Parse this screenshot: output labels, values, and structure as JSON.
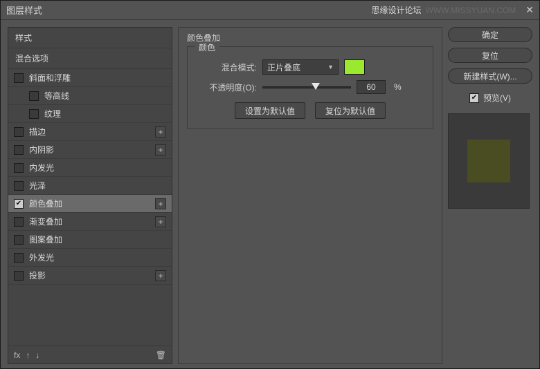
{
  "titlebar": {
    "title": "图层样式",
    "watermark_label": "思缘设计论坛",
    "watermark_url": "WWW.MISSYUAN.COM"
  },
  "left": {
    "styles_header": "样式",
    "blend_header": "混合选项",
    "items": [
      {
        "label": "斜面和浮雕",
        "indent": false,
        "plus": false,
        "checked": false
      },
      {
        "label": "等高线",
        "indent": true,
        "plus": false,
        "checked": false
      },
      {
        "label": "纹理",
        "indent": true,
        "plus": false,
        "checked": false
      },
      {
        "label": "描边",
        "indent": false,
        "plus": true,
        "checked": false
      },
      {
        "label": "内阴影",
        "indent": false,
        "plus": true,
        "checked": false
      },
      {
        "label": "内发光",
        "indent": false,
        "plus": false,
        "checked": false
      },
      {
        "label": "光泽",
        "indent": false,
        "plus": false,
        "checked": false
      },
      {
        "label": "颜色叠加",
        "indent": false,
        "plus": true,
        "checked": true,
        "selected": true
      },
      {
        "label": "渐变叠加",
        "indent": false,
        "plus": true,
        "checked": false
      },
      {
        "label": "图案叠加",
        "indent": false,
        "plus": false,
        "checked": false
      },
      {
        "label": "外发光",
        "indent": false,
        "plus": false,
        "checked": false
      },
      {
        "label": "投影",
        "indent": false,
        "plus": true,
        "checked": false
      }
    ],
    "footer": {
      "fx": "fx",
      "up": "↑",
      "down": "↓",
      "trash": "🗑"
    }
  },
  "middle": {
    "section_title": "颜色叠加",
    "group_label": "颜色",
    "blend_mode_label": "混合模式:",
    "blend_mode_value": "正片叠底",
    "swatch_color": "#9AE92E",
    "opacity_label": "不透明度(O):",
    "opacity_value": "60",
    "opacity_unit": "%",
    "opacity_percent": 60,
    "set_default": "设置为默认值",
    "reset_default": "复位为默认值"
  },
  "right": {
    "ok": "确定",
    "cancel": "复位",
    "new_style": "新建样式(W)...",
    "preview_label": "预览(V)"
  }
}
